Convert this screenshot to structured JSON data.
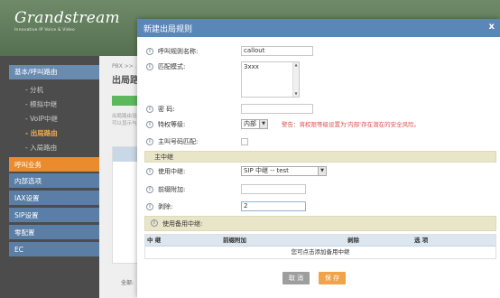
{
  "app": {
    "logo_text": "Grandstream",
    "logo_tagline": "Innovative IP Voice & Video",
    "breadcrumb": "PBX >> ...",
    "content_title": "出局路由",
    "desc_line1": "出局路由设置",
    "desc_line2": "可以显示与...",
    "total_label": "全部:"
  },
  "sidebar": {
    "header": "基本/呼叫路由",
    "sub_items": [
      "分机",
      "模拟中继",
      "VoIP中继",
      "出局路由",
      "入局路由"
    ],
    "active_sub": "出局路由",
    "main_items": [
      "呼叫业务",
      "内部选项",
      "IAX设置",
      "SIP设置",
      "零配置",
      "EC"
    ]
  },
  "dialog": {
    "title": "新建出局规则",
    "close": "x",
    "fields": {
      "rule_name": {
        "label": "呼叫规则名称:",
        "value": "callout"
      },
      "pattern": {
        "label": "匹配模式:",
        "value": "3xxx"
      },
      "password": {
        "label": "密 码:",
        "value": ""
      },
      "privilege": {
        "label": "特权等级:",
        "value": "内部",
        "warning": "警告：将权限等级设置为'内部'存在潜在的安全风险。"
      },
      "callerid_match": {
        "label": "主叫号码匹配:"
      }
    },
    "main_trunk": {
      "section": "主中继",
      "use_trunk_label": "使用中继:",
      "use_trunk_value": "SIP 中继 -- test",
      "prepend_label": "前缀附加:",
      "prepend_value": "",
      "strip_label": "剥除:",
      "strip_value": "2"
    },
    "backup": {
      "section": "使用备用中继:",
      "columns": [
        "中 继",
        "前缀附加",
        "剥除",
        "选 项"
      ],
      "empty_text": "您可点击添加备用中继"
    },
    "buttons": {
      "cancel": "取 消",
      "save": "保 存"
    }
  },
  "colors": {
    "titlebar": "#5a87b8",
    "save": "#f0a348",
    "cancel": "#9e9e9e",
    "warning": "#d9534f",
    "section": "#e9e5c8"
  }
}
